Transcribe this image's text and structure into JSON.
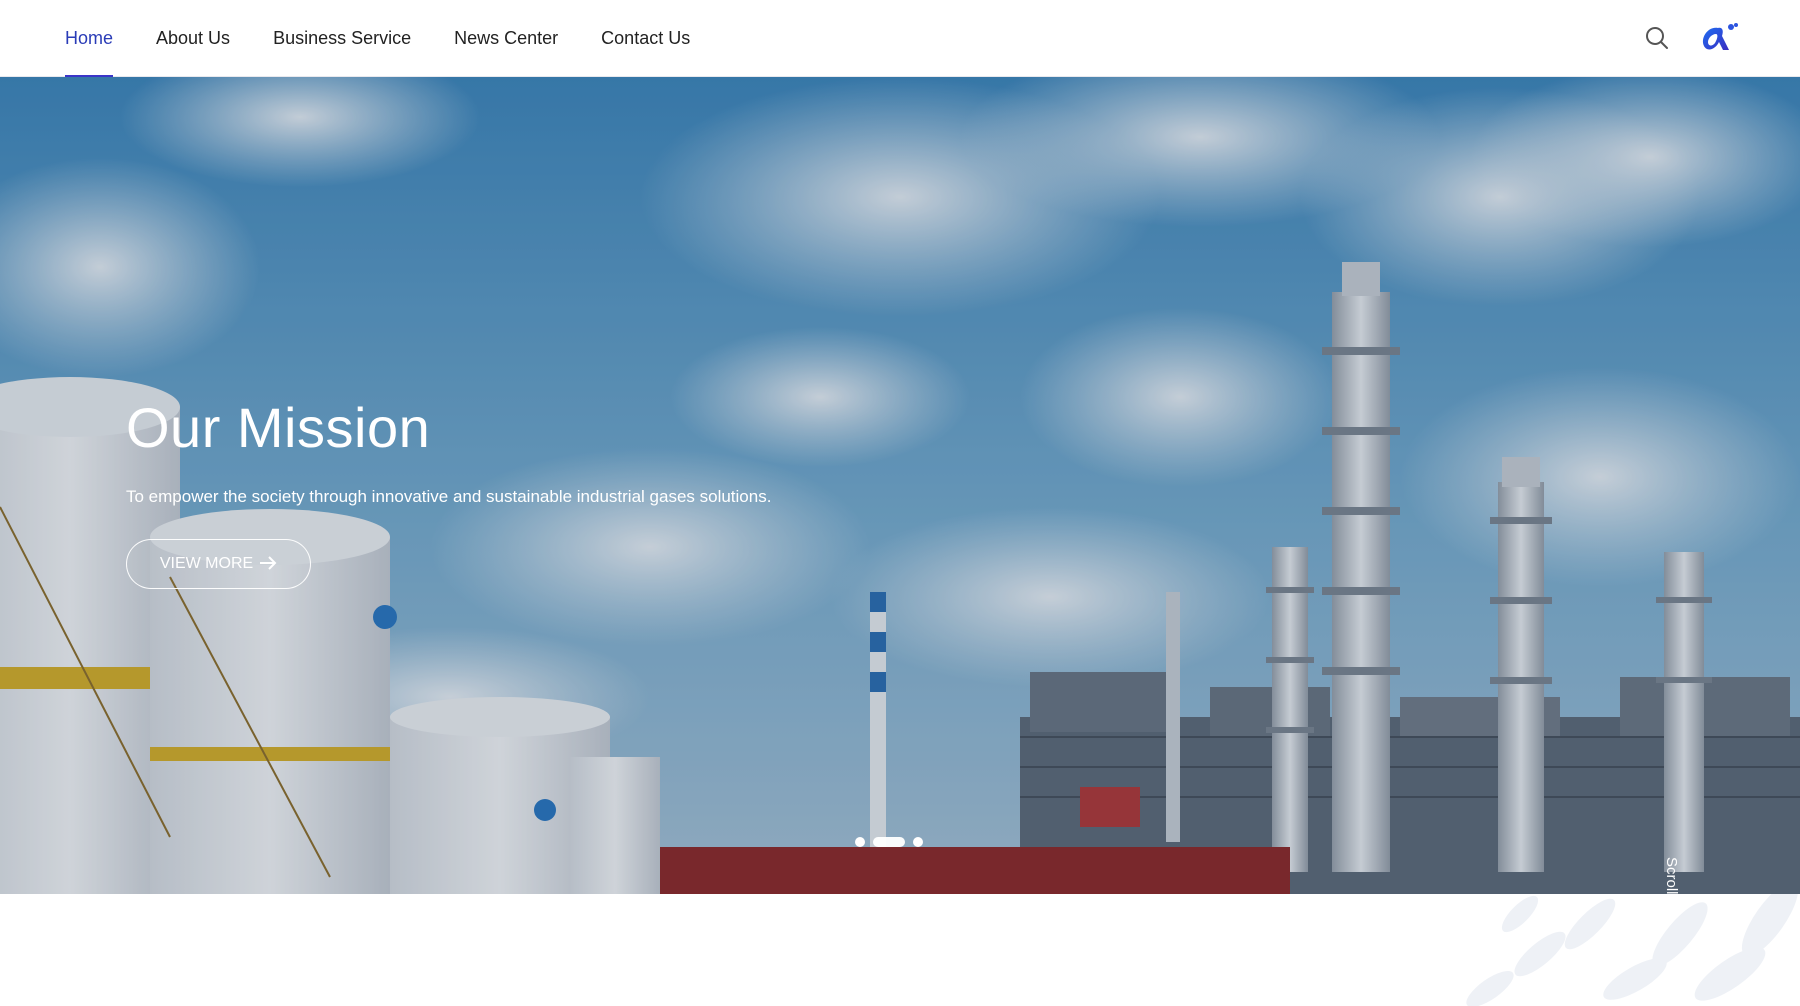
{
  "nav": {
    "items": [
      {
        "label": "Home",
        "active": true
      },
      {
        "label": "About Us",
        "active": false
      },
      {
        "label": "Business Service",
        "active": false
      },
      {
        "label": "News Center",
        "active": false
      },
      {
        "label": "Contact Us",
        "active": false
      }
    ],
    "search_icon": "search-icon",
    "logo_icon": "brand-logo-icon"
  },
  "hero": {
    "title": "Our Mission",
    "subtitle": "To empower the society through innovative and sustainable industrial gases solutions.",
    "button_label": "VIEW MORE",
    "button_icon": "arrow-right-icon",
    "scroll_label": "Scroll down",
    "carousel": {
      "slides": 3,
      "active_index": 1
    }
  },
  "colors": {
    "accent": "#2a3cb7",
    "underline": "#3b35c8",
    "text": "#222222",
    "white": "#ffffff"
  }
}
